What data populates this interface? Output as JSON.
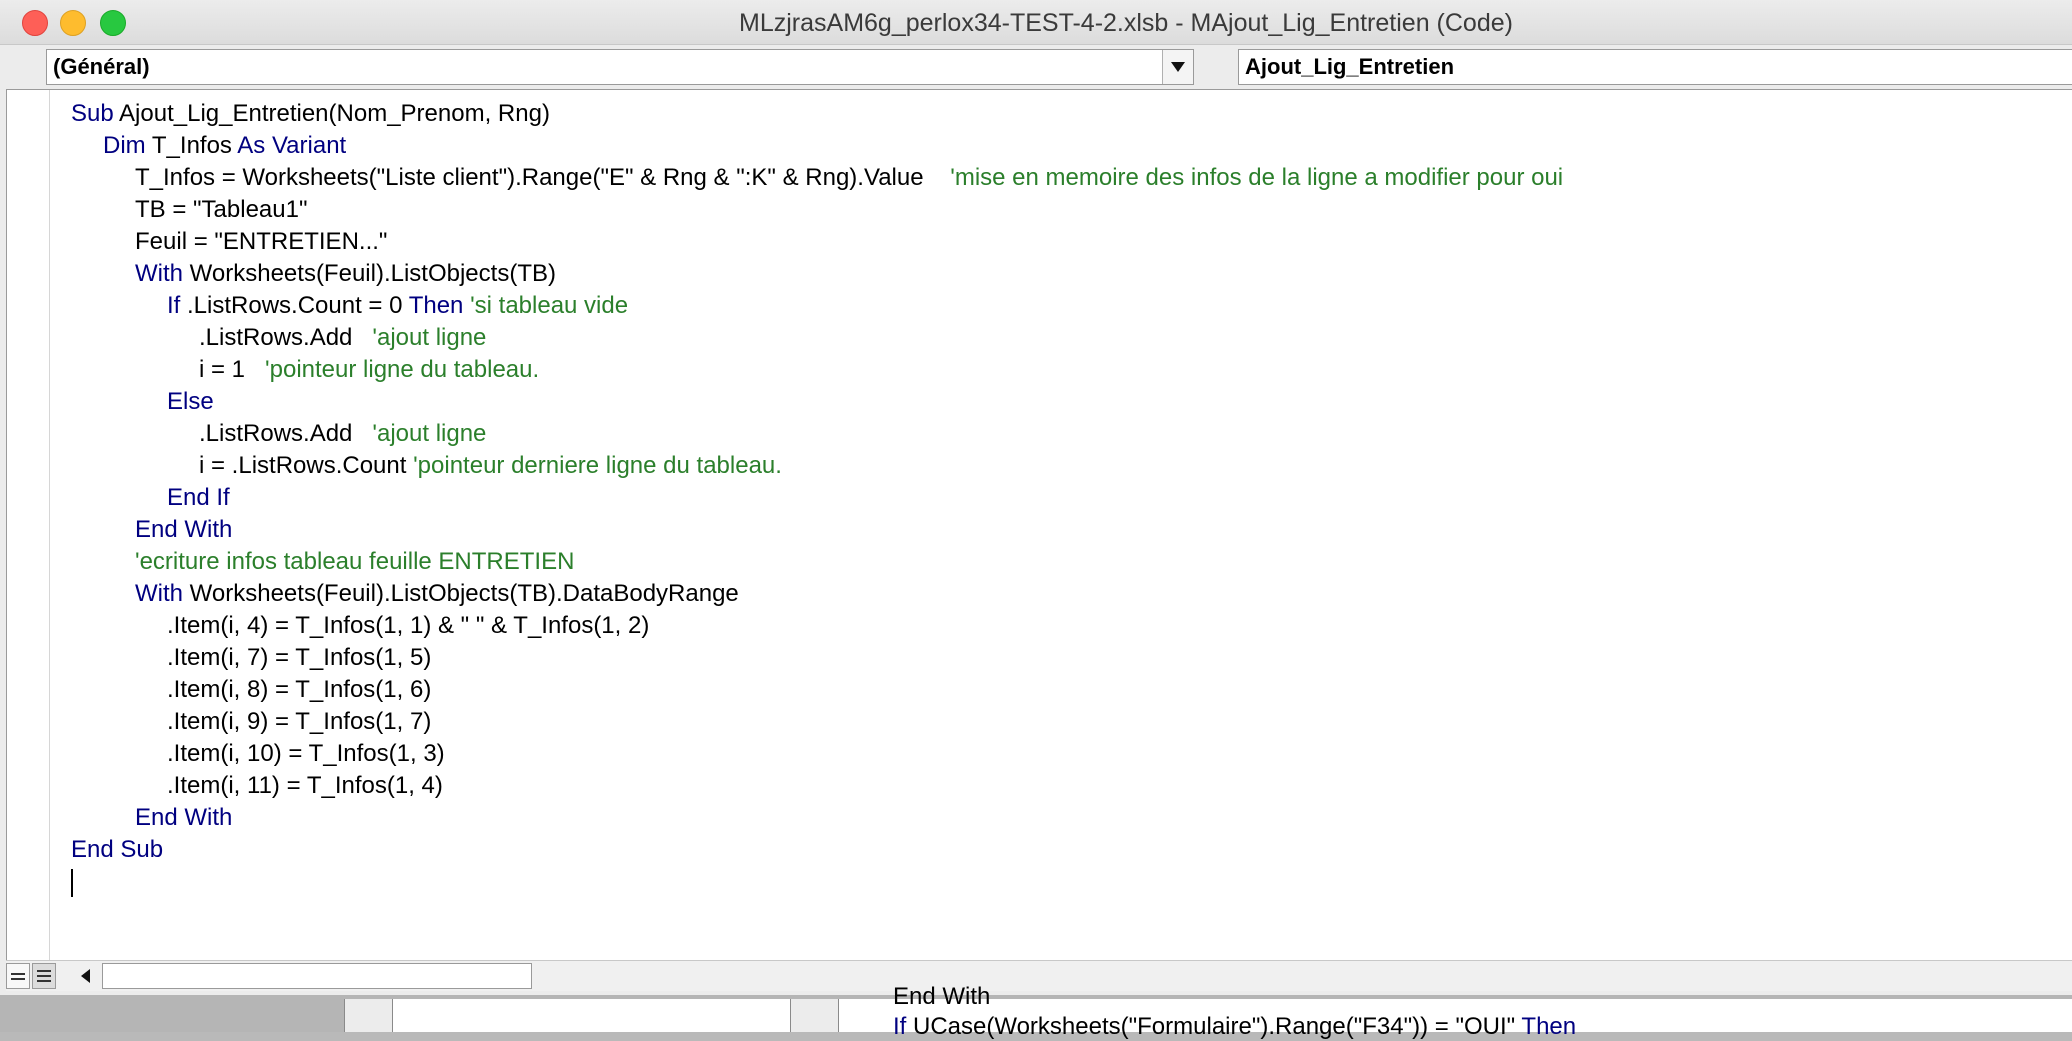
{
  "window": {
    "title": "MLzjrasAM6g_perlox34-TEST-4-2.xlsb - MAjout_Lig_Entretien (Code)"
  },
  "toolbar": {
    "object_combo": "(Général)",
    "procedure_combo": "Ajout_Lig_Entretien"
  },
  "code_lines": [
    {
      "indent": 0,
      "segments": [
        {
          "t": "Sub",
          "k": "kw"
        },
        {
          "t": " Ajout_Lig_Entretien(Nom_Prenom, Rng)",
          "k": ""
        }
      ]
    },
    {
      "indent": 1,
      "segments": [
        {
          "t": "Dim",
          "k": "kw"
        },
        {
          "t": " T_Infos ",
          "k": ""
        },
        {
          "t": "As Variant",
          "k": "kw"
        }
      ]
    },
    {
      "indent": 2,
      "segments": [
        {
          "t": "T_Infos = Worksheets(\"Liste client\").Range(\"E\" & Rng & \":K\" & Rng).Value    ",
          "k": ""
        },
        {
          "t": "'mise en memoire des infos de la ligne a modifier pour oui",
          "k": "cm"
        }
      ]
    },
    {
      "indent": 2,
      "segments": [
        {
          "t": "TB = \"Tableau1\"",
          "k": ""
        }
      ]
    },
    {
      "indent": 2,
      "segments": [
        {
          "t": "Feuil = \"ENTRETIEN...\"",
          "k": ""
        }
      ]
    },
    {
      "indent": 2,
      "segments": [
        {
          "t": "With",
          "k": "kw"
        },
        {
          "t": " Worksheets(Feuil).ListObjects(TB)",
          "k": ""
        }
      ]
    },
    {
      "indent": 3,
      "segments": [
        {
          "t": "If",
          "k": "kw"
        },
        {
          "t": " .ListRows.Count = 0 ",
          "k": ""
        },
        {
          "t": "Then",
          "k": "kw"
        },
        {
          "t": " ",
          "k": ""
        },
        {
          "t": "'si tableau vide",
          "k": "cm"
        }
      ]
    },
    {
      "indent": 4,
      "segments": [
        {
          "t": ".ListRows.Add   ",
          "k": ""
        },
        {
          "t": "'ajout ligne",
          "k": "cm"
        }
      ]
    },
    {
      "indent": 4,
      "segments": [
        {
          "t": "i = 1   ",
          "k": ""
        },
        {
          "t": "'pointeur ligne du tableau.",
          "k": "cm"
        }
      ]
    },
    {
      "indent": 3,
      "segments": [
        {
          "t": "Else",
          "k": "kw"
        }
      ]
    },
    {
      "indent": 4,
      "segments": [
        {
          "t": ".ListRows.Add   ",
          "k": ""
        },
        {
          "t": "'ajout ligne",
          "k": "cm"
        }
      ]
    },
    {
      "indent": 4,
      "segments": [
        {
          "t": "i = .ListRows.Count ",
          "k": ""
        },
        {
          "t": "'pointeur derniere ligne du tableau.",
          "k": "cm"
        }
      ]
    },
    {
      "indent": 3,
      "segments": [
        {
          "t": "End If",
          "k": "kw"
        }
      ]
    },
    {
      "indent": 2,
      "segments": [
        {
          "t": "End With",
          "k": "kw"
        }
      ]
    },
    {
      "indent": 2,
      "segments": [
        {
          "t": "'ecriture infos tableau feuille ENTRETIEN",
          "k": "cm"
        }
      ]
    },
    {
      "indent": 2,
      "segments": [
        {
          "t": "With",
          "k": "kw"
        },
        {
          "t": " Worksheets(Feuil).ListObjects(TB).DataBodyRange",
          "k": ""
        }
      ]
    },
    {
      "indent": 3,
      "segments": [
        {
          "t": ".Item(i, 4) = T_Infos(1, 1) & \" \" & T_Infos(1, 2)",
          "k": ""
        }
      ]
    },
    {
      "indent": 3,
      "segments": [
        {
          "t": ".Item(i, 7) = T_Infos(1, 5)",
          "k": ""
        }
      ]
    },
    {
      "indent": 3,
      "segments": [
        {
          "t": ".Item(i, 8) = T_Infos(1, 6)",
          "k": ""
        }
      ]
    },
    {
      "indent": 3,
      "segments": [
        {
          "t": ".Item(i, 9) = T_Infos(1, 7)",
          "k": ""
        }
      ]
    },
    {
      "indent": 3,
      "segments": [
        {
          "t": ".Item(i, 10) = T_Infos(1, 3)",
          "k": ""
        }
      ]
    },
    {
      "indent": 3,
      "segments": [
        {
          "t": ".Item(i, 11) = T_Infos(1, 4)",
          "k": ""
        }
      ]
    },
    {
      "indent": 2,
      "segments": [
        {
          "t": "End With",
          "k": "kw"
        }
      ]
    },
    {
      "indent": 0,
      "segments": [
        {
          "t": "End Sub",
          "k": "kw"
        }
      ]
    }
  ],
  "background_window": {
    "line1": "End With",
    "line2_pre": "If",
    "line2_mid": " UCase(Worksheets(\"Formulaire\").Range(\"F34\")) = \"OUI\" ",
    "line2_post": "Then"
  },
  "colors": {
    "keyword": "#000080",
    "comment": "#2b7f2b",
    "text": "#000000"
  }
}
